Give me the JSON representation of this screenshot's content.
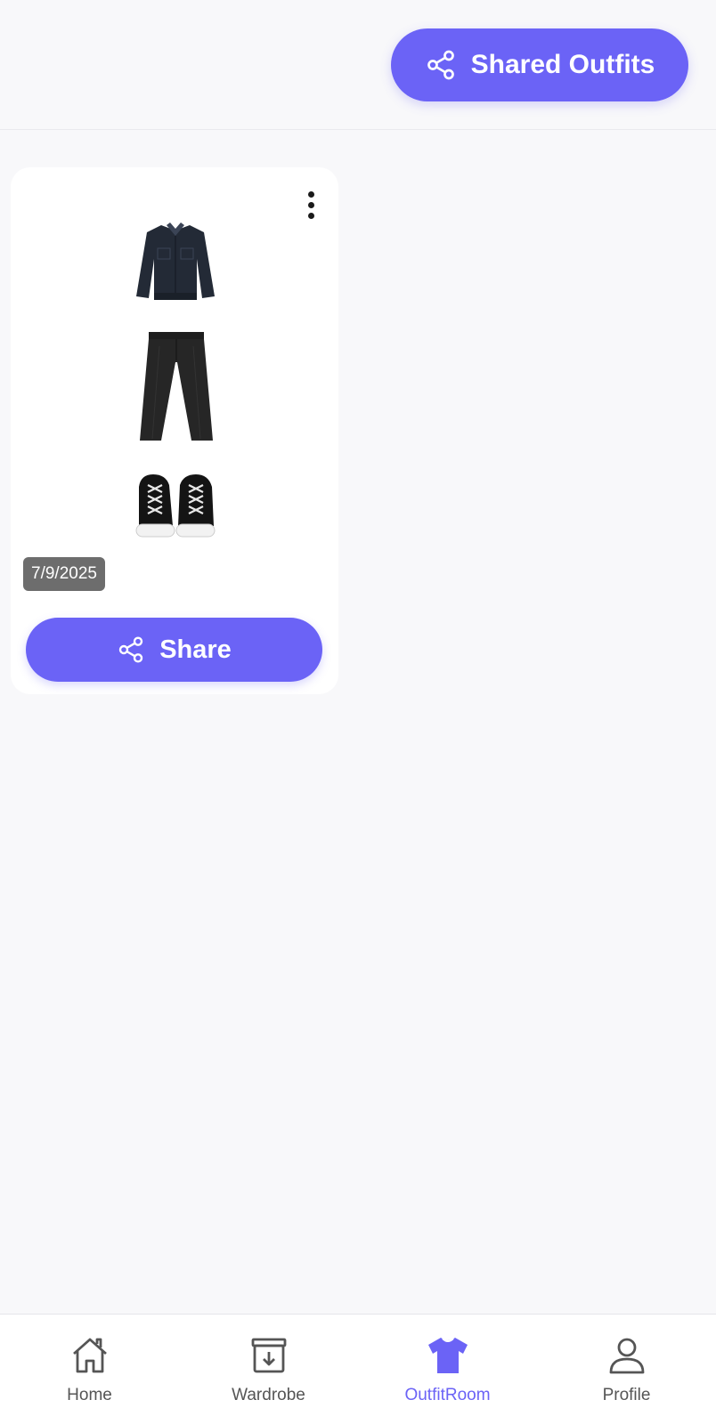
{
  "header": {
    "shared_outfits_label": "Shared Outfits",
    "shared_icon": "share-icon"
  },
  "outfits": [
    {
      "date": "7/9/2025",
      "items": [
        "jacket",
        "pants",
        "sneakers"
      ],
      "share_label": "Share",
      "menu_icon": "more-vertical-icon"
    }
  ],
  "nav": {
    "items": [
      {
        "label": "Home",
        "icon": "home-icon",
        "active": false
      },
      {
        "label": "Wardrobe",
        "icon": "wardrobe-icon",
        "active": false
      },
      {
        "label": "OutfitRoom",
        "icon": "tshirt-icon",
        "active": true
      },
      {
        "label": "Profile",
        "icon": "profile-icon",
        "active": false
      }
    ]
  },
  "colors": {
    "accent": "#6b63f6",
    "background": "#f8f8fa",
    "card": "#ffffff",
    "badge": "#6d6d6d",
    "inactive": "#555555"
  }
}
